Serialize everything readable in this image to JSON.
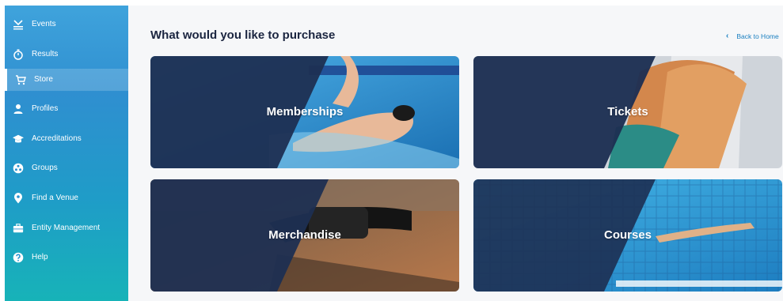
{
  "sidebar": {
    "items": [
      {
        "label": "Events",
        "icon": "events-icon"
      },
      {
        "label": "Results",
        "icon": "stopwatch-icon"
      },
      {
        "label": "Store",
        "icon": "cart-icon",
        "active": true
      },
      {
        "label": "Profiles",
        "icon": "person-icon"
      },
      {
        "label": "Accreditations",
        "icon": "graduation-cap-icon"
      },
      {
        "label": "Groups",
        "icon": "groups-icon"
      },
      {
        "label": "Find a Venue",
        "icon": "location-pin-icon"
      },
      {
        "label": "Entity Management",
        "icon": "briefcase-icon"
      },
      {
        "label": "Help",
        "icon": "help-icon"
      }
    ]
  },
  "main": {
    "title": "What would you like to purchase",
    "back_link": "Back to Home",
    "cards": [
      {
        "label": "Memberships"
      },
      {
        "label": "Tickets"
      },
      {
        "label": "Merchandise"
      },
      {
        "label": "Courses"
      }
    ]
  },
  "colors": {
    "overlay_navy": "#1d2f52",
    "accent_blue": "#1a7fc0",
    "title_text": "#1b2540"
  }
}
